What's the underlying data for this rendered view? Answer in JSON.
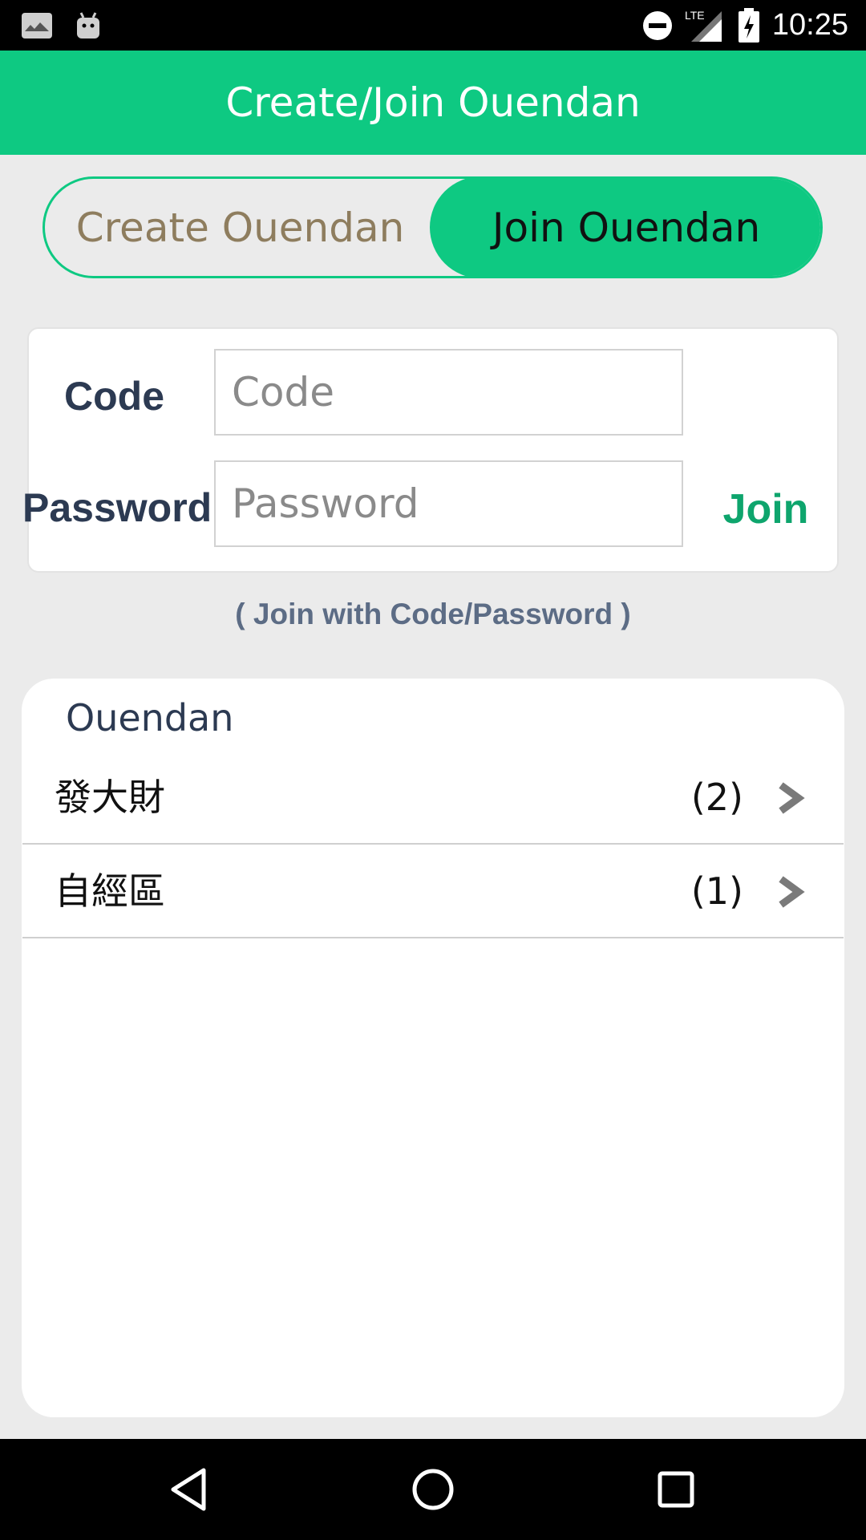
{
  "status_bar": {
    "time": "10:25",
    "icons": [
      "photos-icon",
      "android-icon",
      "do-not-disturb-icon",
      "lte-signal-icon",
      "battery-charging-icon"
    ],
    "network_label": "LTE"
  },
  "app_bar": {
    "title": "Create/Join Ouendan"
  },
  "segment": {
    "create_label": "Create Ouendan",
    "join_label": "Join Ouendan",
    "selected": "Join Ouendan"
  },
  "form": {
    "code_label": "Code",
    "code_placeholder": "Code",
    "password_label": "Password",
    "password_placeholder": "Password",
    "join_label": "Join",
    "hint": "( Join with Code/Password )"
  },
  "list": {
    "header": "Ouendan",
    "items": [
      {
        "name": "發大財",
        "count": "(2)"
      },
      {
        "name": "自經區",
        "count": "(1)"
      }
    ]
  },
  "nav_bar": {
    "buttons": [
      "back-icon",
      "home-icon",
      "recents-icon"
    ]
  },
  "colors": {
    "accent": "#0ec982",
    "join_text": "#0ea56d",
    "label_text": "#2c3a52",
    "inactive_segment_text": "#8e7d5e"
  }
}
